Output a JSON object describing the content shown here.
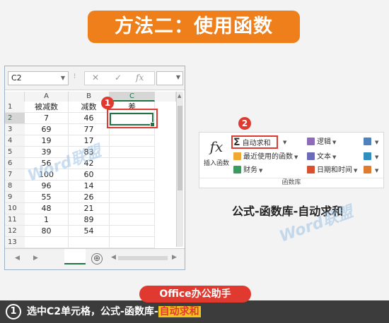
{
  "title": "方法二：使用函数",
  "spreadsheet": {
    "name_box": "C2",
    "formula_buttons": [
      "✕",
      "✓",
      "fx"
    ],
    "columns": [
      "A",
      "B",
      "C"
    ],
    "rows": [
      {
        "n": "1",
        "a": "被减数",
        "b": "减数",
        "c": "差"
      },
      {
        "n": "2",
        "a": "7",
        "b": "46",
        "c": ""
      },
      {
        "n": "3",
        "a": "69",
        "b": "77",
        "c": ""
      },
      {
        "n": "4",
        "a": "19",
        "b": "17",
        "c": ""
      },
      {
        "n": "5",
        "a": "39",
        "b": "83",
        "c": ""
      },
      {
        "n": "6",
        "a": "56",
        "b": "42",
        "c": ""
      },
      {
        "n": "7",
        "a": "100",
        "b": "60",
        "c": ""
      },
      {
        "n": "8",
        "a": "96",
        "b": "14",
        "c": ""
      },
      {
        "n": "9",
        "a": "55",
        "b": "26",
        "c": ""
      },
      {
        "n": "10",
        "a": "48",
        "b": "21",
        "c": ""
      },
      {
        "n": "11",
        "a": "1",
        "b": "89",
        "c": ""
      },
      {
        "n": "12",
        "a": "80",
        "b": "54",
        "c": ""
      },
      {
        "n": "13",
        "a": "",
        "b": "",
        "c": ""
      },
      {
        "n": "14",
        "a": "",
        "b": "",
        "c": ""
      }
    ],
    "add_sheet_symbol": "⊕"
  },
  "markers": {
    "one": "1",
    "two": "2"
  },
  "ribbon": {
    "insert_function_icon": "fx",
    "insert_function_label": "插入函数",
    "autosum": "自动求和",
    "recent": "最近使用的函数",
    "financial": "财务",
    "logical": "逻辑",
    "text": "文本",
    "datetime": "日期和时间",
    "group_label": "函数库"
  },
  "caption": "公式-函数库-自动求和",
  "watermark": "Word联盟",
  "brand": "Office办公助手",
  "step": {
    "number": "1",
    "text": "选中C2单元格，公式-函数库-",
    "highlight": "自动求和"
  },
  "colors": {
    "accent_orange": "#ef7f1a",
    "marker_red": "#e03a30",
    "excel_green": "#217346",
    "highlight_yellow": "#f3c31d"
  }
}
